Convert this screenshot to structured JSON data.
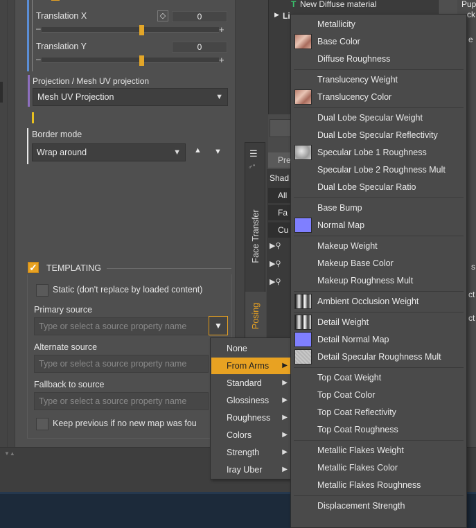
{
  "properties": {
    "translation_x": {
      "label": "Translation X",
      "value": "0",
      "knob_pct": 0.5
    },
    "translation_y": {
      "label": "Translation Y",
      "value": "0",
      "knob_pct": 0.5
    },
    "projection": {
      "label": "Projection / Mesh UV projection",
      "value": "Mesh UV Projection"
    },
    "border_mode": {
      "label": "Border mode",
      "value": "Wrap around"
    }
  },
  "templating": {
    "title": "TEMPLATING",
    "static_label": "Static (don't replace by loaded content)",
    "primary_label": "Primary source",
    "primary_placeholder": "Type or select a source property name",
    "alternate_label": "Alternate source",
    "alternate_placeholder": "Type or select a source property name",
    "fallback_label": "Fallback to source",
    "fallback_placeholder": "Type or select a source property name",
    "keep_previous_label": "Keep previous if no new map was fou"
  },
  "tree": {
    "new_material": "New Diffuse material",
    "list_row": "Li",
    "button_glyph": "B",
    "right_header": "Pup"
  },
  "side_tabs": {
    "face_transfer": "Face Transfer",
    "posing": "Posing",
    "pre_label": "Pre",
    "shader_label": "Shad",
    "rows": [
      "All",
      "Fa",
      "Cu"
    ]
  },
  "right_edge_letters": [
    "ck",
    "e",
    "s",
    "ct",
    "ct"
  ],
  "menu_sources": {
    "items": [
      {
        "label": "None",
        "submenu": false,
        "active": false
      },
      {
        "label": "From Arms",
        "submenu": true,
        "active": true
      },
      {
        "label": "Standard",
        "submenu": true,
        "active": false
      },
      {
        "label": "Glossiness",
        "submenu": true,
        "active": false
      },
      {
        "label": "Roughness",
        "submenu": true,
        "active": false
      },
      {
        "label": "Colors",
        "submenu": true,
        "active": false
      },
      {
        "label": "Strength",
        "submenu": true,
        "active": false
      },
      {
        "label": "Iray Uber",
        "submenu": true,
        "active": false
      }
    ]
  },
  "menu_from_arms": {
    "items": [
      {
        "label": "Metallicity",
        "thumb": ""
      },
      {
        "label": "Base Color",
        "thumb": "skin"
      },
      {
        "label": "Diffuse Roughness",
        "thumb": ""
      },
      {
        "sep": true
      },
      {
        "label": "Translucency Weight",
        "thumb": ""
      },
      {
        "label": "Translucency Color",
        "thumb": "skin"
      },
      {
        "sep": true
      },
      {
        "label": "Dual Lobe Specular Weight",
        "thumb": ""
      },
      {
        "label": "Dual Lobe Specular Reflectivity",
        "thumb": ""
      },
      {
        "label": "Specular Lobe 1 Roughness",
        "thumb": "gray"
      },
      {
        "label": "Specular Lobe 2 Roughness Mult",
        "thumb": ""
      },
      {
        "label": "Dual Lobe Specular Ratio",
        "thumb": ""
      },
      {
        "sep": true
      },
      {
        "label": "Base Bump",
        "thumb": ""
      },
      {
        "label": "Normal Map",
        "thumb": "blue"
      },
      {
        "sep": true
      },
      {
        "label": "Makeup Weight",
        "thumb": ""
      },
      {
        "label": "Makeup Base Color",
        "thumb": ""
      },
      {
        "label": "Makeup Roughness Mult",
        "thumb": ""
      },
      {
        "sep": true
      },
      {
        "label": "Ambient Occlusion Weight",
        "thumb": "bw"
      },
      {
        "sep": true
      },
      {
        "label": "Detail Weight",
        "thumb": "bw"
      },
      {
        "label": "Detail Normal Map",
        "thumb": "blue"
      },
      {
        "label": "Detail Specular Roughness Mult",
        "thumb": "lightgray"
      },
      {
        "sep": true
      },
      {
        "label": "Top Coat Weight",
        "thumb": ""
      },
      {
        "label": "Top Coat Color",
        "thumb": ""
      },
      {
        "label": "Top Coat Reflectivity",
        "thumb": ""
      },
      {
        "label": "Top Coat Roughness",
        "thumb": ""
      },
      {
        "sep": true
      },
      {
        "label": "Metallic Flakes Weight",
        "thumb": ""
      },
      {
        "label": "Metallic Flakes Color",
        "thumb": ""
      },
      {
        "label": "Metallic Flakes Roughness",
        "thumb": ""
      },
      {
        "sep": true
      },
      {
        "label": "Displacement Strength",
        "thumb": ""
      }
    ]
  },
  "colors": {
    "accent_orange": "#e8a222",
    "accent_blue": "#5b8ed6",
    "accent_purple": "#8e6fbf",
    "accent_yellow": "#e8c020",
    "tree_green": "#39c16b"
  }
}
